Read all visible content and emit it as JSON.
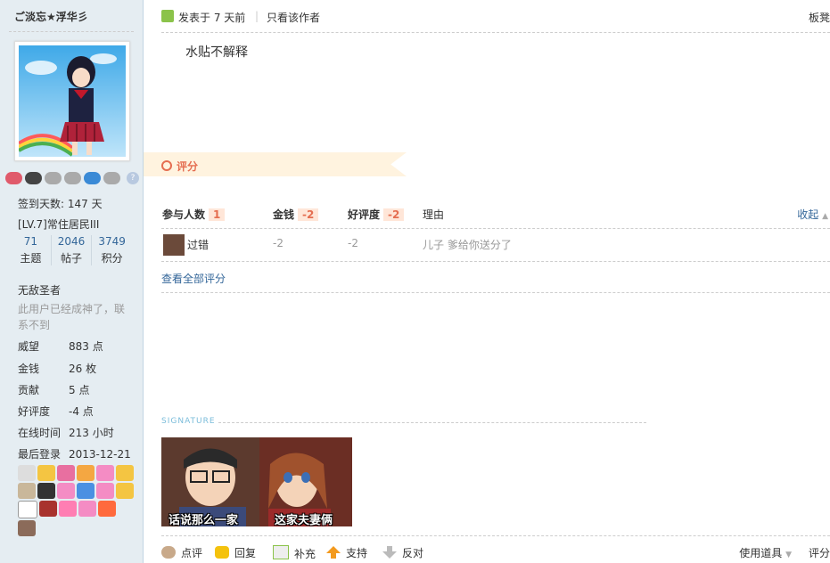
{
  "user": {
    "name": "ご淡忘★浮华彡",
    "sign_days": "签到天数: 147 天",
    "level": "[LV.7]常住居民III",
    "counts": [
      {
        "num": "71",
        "label": "主题"
      },
      {
        "num": "2046",
        "label": "帖子"
      },
      {
        "num": "3749",
        "label": "积分"
      }
    ],
    "title": "无敌圣者",
    "description": "此用户已经成神了，联系不到",
    "stats": [
      {
        "k": "威望",
        "v": "883 点"
      },
      {
        "k": "金钱",
        "v": "26 枚"
      },
      {
        "k": "贡献",
        "v": "5 点"
      },
      {
        "k": "好评度",
        "v": "-4 点"
      },
      {
        "k": "在线时间",
        "v": "213 小时"
      },
      {
        "k": "最后登录",
        "v": "2013-12-21"
      }
    ]
  },
  "post": {
    "posted": "发表于 7 天前",
    "separator": "|",
    "only_author": "只看该作者",
    "floor": "板凳",
    "content": "水贴不解释"
  },
  "rating": {
    "title": "评分",
    "headers": {
      "participants": "参与人数",
      "participants_count": "1",
      "money": "金钱",
      "money_total": "-2",
      "reputation": "好评度",
      "reputation_total": "-2",
      "reason": "理由",
      "collapse": "收起"
    },
    "row": {
      "user": "过错",
      "money": "-2",
      "reputation": "-2",
      "reason": "儿子 爹给你送分了"
    },
    "view_all": "查看全部评分"
  },
  "signature": {
    "label": "SIGNATURE",
    "caption_left": "话说那么一家",
    "caption_right": "这家夫妻俩"
  },
  "actions": {
    "comment": "点评",
    "reply": "回复",
    "supplement": "补充",
    "support": "支持",
    "oppose": "反对",
    "use_tools": "使用道具",
    "rate": "评分"
  },
  "colors": {
    "sidebar_bg": "#E5EDF2",
    "link": "#336699",
    "accent": "#E56E51"
  }
}
